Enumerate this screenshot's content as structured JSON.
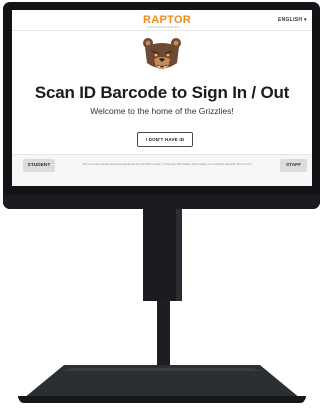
{
  "header": {
    "logo_text": "RAPTOR",
    "logo_tagline": "TECHNOLOGIES",
    "language": "ENGLISH ▾"
  },
  "mascot": {
    "name": "grizzly-bear-icon"
  },
  "main": {
    "title": "Scan ID Barcode to Sign In / Out",
    "subtitle": "Welcome to the home of the Grizzlies!",
    "no_id_button": "I DON'T HAVE ID"
  },
  "footer": {
    "student_button": "STUDENT",
    "staff_button": "STAFF",
    "legal_text": "The use of this website constitutes agreement with the Terms of Use. © Copyright 2020 Raptor Technologies, LLC. All rights reserved. Terms of Use"
  },
  "colors": {
    "brand_orange": "#f28a1b",
    "bezel": "#111316",
    "bear_brown": "#6e4a35"
  }
}
